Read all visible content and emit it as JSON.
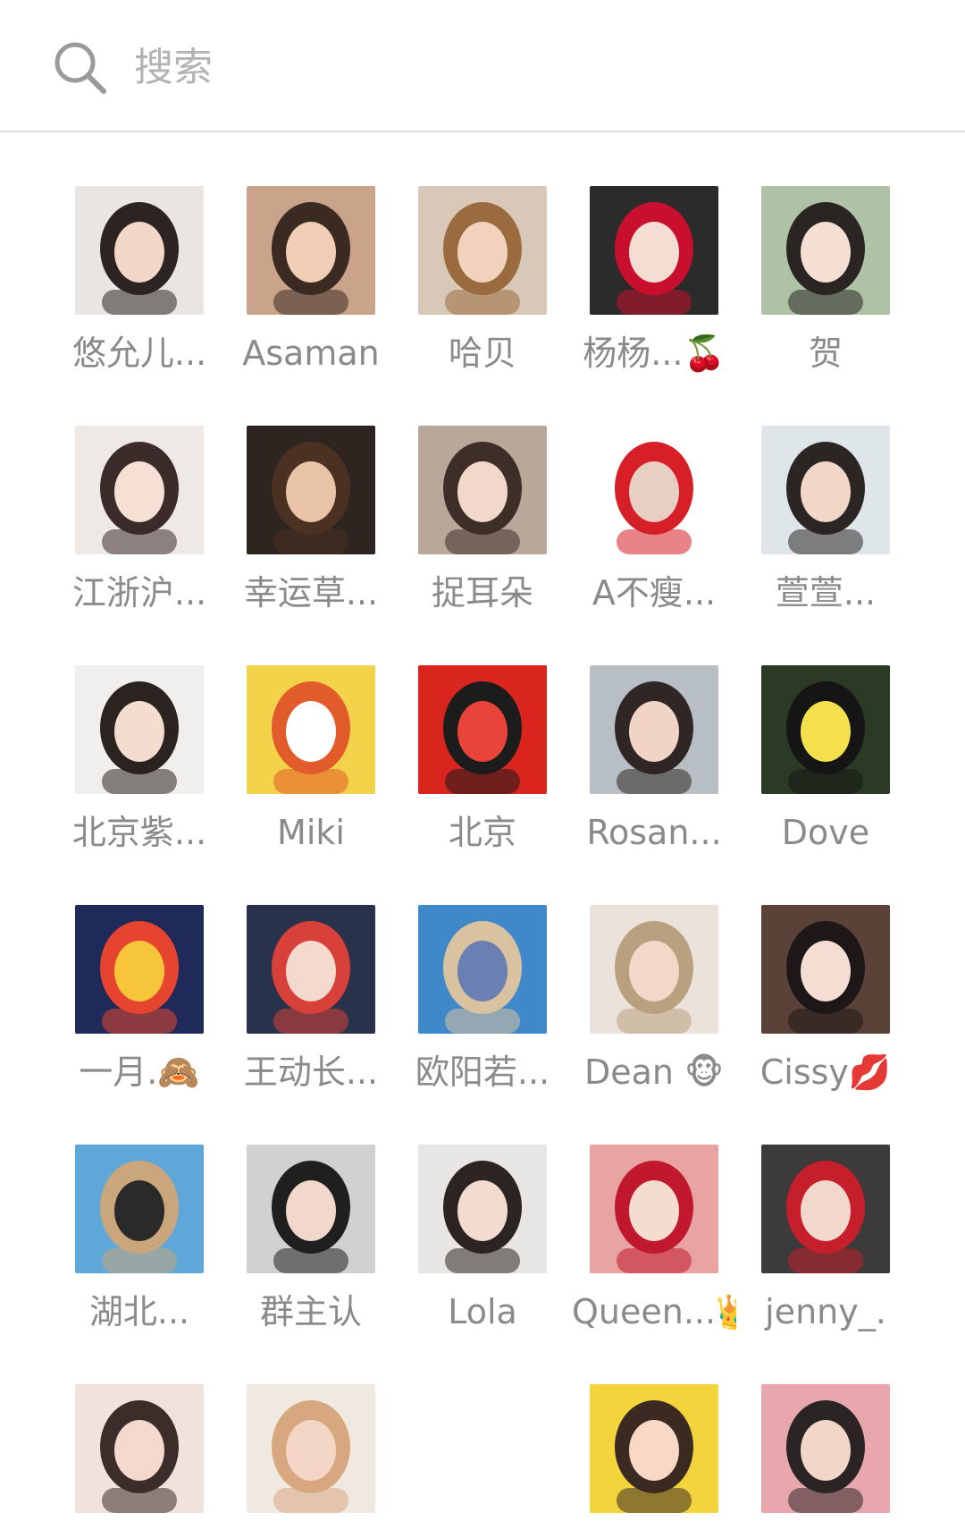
{
  "search": {
    "placeholder": "搜索"
  },
  "members": [
    {
      "name": "悠允儿...",
      "icon": "woman-selfie-avatar",
      "colors": [
        "#e9e5e2",
        "#2b2423",
        "#f2d6c6"
      ]
    },
    {
      "name": "Asaman",
      "icon": "woman-long-hair-avatar",
      "colors": [
        "#c9a48b",
        "#3a2a22",
        "#f0cdb5"
      ]
    },
    {
      "name": "哈贝",
      "icon": "woman-smiling-avatar",
      "colors": [
        "#d7c8b7",
        "#9a6b3e",
        "#f1d2bd"
      ]
    },
    {
      "name": "杨杨...🍒",
      "icon": "woman-mouse-ears-avatar",
      "colors": [
        "#2c2b2b",
        "#c8102e",
        "#f4ddd2"
      ]
    },
    {
      "name": "贺",
      "icon": "woman-outdoor-avatar",
      "colors": [
        "#aec2a5",
        "#2a2422",
        "#f5dfd3"
      ]
    },
    {
      "name": "江浙沪...",
      "icon": "woman-portrait-avatar",
      "colors": [
        "#efe9e6",
        "#3b2c2a",
        "#f6e0d6"
      ]
    },
    {
      "name": "幸运草...",
      "icon": "woman-dark-photo-avatar",
      "colors": [
        "#2e2520",
        "#4a3122",
        "#e8c3a6"
      ]
    },
    {
      "name": "捉耳朵",
      "icon": "woman-closeup-avatar",
      "colors": [
        "#b9a79a",
        "#3d2e27",
        "#f1d8cb"
      ]
    },
    {
      "name": "A不瘦...",
      "icon": "santa-hat-avatar",
      "colors": [
        "#ffffff",
        "#d61f26",
        "#e8cfc3"
      ]
    },
    {
      "name": "萱萱...",
      "icon": "woman-window-avatar",
      "colors": [
        "#dfe6ea",
        "#2b2524",
        "#f2d7c8"
      ]
    },
    {
      "name": "北京紫...",
      "icon": "woman-white-shirt-avatar",
      "colors": [
        "#f0efed",
        "#2b2320",
        "#f4ddcf"
      ]
    },
    {
      "name": "Miki",
      "icon": "cartoon-bunny-avatar",
      "colors": [
        "#f3d34a",
        "#e25b2a",
        "#ffffff"
      ]
    },
    {
      "name": "北京",
      "icon": "fu-character-avatar",
      "colors": [
        "#d9251d",
        "#1c1c1c",
        "#e8443a"
      ]
    },
    {
      "name": "Rosan...",
      "icon": "woman-street-avatar",
      "colors": [
        "#b7bfc4",
        "#2f2625",
        "#f2d4c6"
      ]
    },
    {
      "name": "Dove",
      "icon": "woman-hat-avatar",
      "colors": [
        "#2a3a24",
        "#151515",
        "#f4e04d"
      ]
    },
    {
      "name": "一月.🙈",
      "icon": "welcome-2018-avatar",
      "colors": [
        "#1f2a5a",
        "#e5452f",
        "#f6c53a"
      ]
    },
    {
      "name": "王动长...",
      "icon": "woman-newyear-avatar",
      "colors": [
        "#28324a",
        "#d8413a",
        "#f4d9cc"
      ]
    },
    {
      "name": "欧阳若...",
      "icon": "woman-beach-dress-avatar",
      "colors": [
        "#3f88c9",
        "#d9c2a0",
        "#6a7fb2"
      ]
    },
    {
      "name": "Dean 🐵",
      "icon": "woman-teddy-avatar",
      "colors": [
        "#ebe2dc",
        "#b9a07f",
        "#f3d8ca"
      ]
    },
    {
      "name": "Cissy💋",
      "icon": "woman-car-avatar",
      "colors": [
        "#5b4238",
        "#1d1717",
        "#f4ddd2"
      ]
    },
    {
      "name": "湖北...",
      "icon": "woman-sunbathing-avatar",
      "colors": [
        "#5fa7d9",
        "#c9a67c",
        "#2a2a2a"
      ]
    },
    {
      "name": "群主认",
      "icon": "woman-bunny-ears-avatar",
      "colors": [
        "#d2d1cf",
        "#1f1f1f",
        "#f1d8cb"
      ]
    },
    {
      "name": "Lola",
      "icon": "woman-wink-avatar",
      "colors": [
        "#e8e6e4",
        "#2b2422",
        "#f3dccf"
      ]
    },
    {
      "name": "Queen...👑",
      "icon": "woman-red-dress-avatar",
      "colors": [
        "#e8a3a3",
        "#c0192e",
        "#f4dccf"
      ]
    },
    {
      "name": "jenny_.",
      "icon": "group-friends-avatar",
      "colors": [
        "#3c3a3a",
        "#c41f2b",
        "#f2d8cc"
      ]
    },
    {
      "name": "",
      "icon": "woman-face-avatar",
      "colors": [
        "#f0e2dc",
        "#3b2d2a",
        "#f4d9cc"
      ]
    },
    {
      "name": "",
      "icon": "puppy-avatar",
      "colors": [
        "#efe9e2",
        "#d7a77f",
        "#f3d6c5"
      ]
    },
    {
      "name": "",
      "icon": "empty-slot",
      "colors": [
        "#ffffff",
        "#ffffff",
        "#ffffff"
      ]
    },
    {
      "name": "",
      "icon": "child-avatar",
      "colors": [
        "#f3d43c",
        "#3b2a22",
        "#f7d9c6"
      ]
    },
    {
      "name": "",
      "icon": "woman-pink-door-avatar",
      "colors": [
        "#e8a6ad",
        "#2b2424",
        "#f2d6c8"
      ]
    }
  ]
}
